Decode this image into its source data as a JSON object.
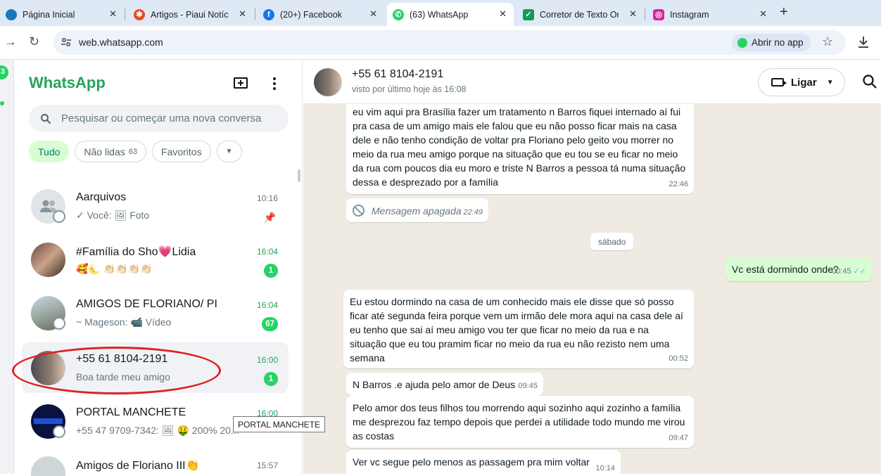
{
  "browser": {
    "tabs": [
      {
        "title": "Página Inicial",
        "icon": "edge-globe-icon",
        "color": "#1b75bb"
      },
      {
        "title": "Artigos - Piaui Notícias",
        "icon": "joomla-icon",
        "color": "#e44d26"
      },
      {
        "title": "(20+) Facebook",
        "icon": "facebook-icon",
        "color": "#1877f2"
      },
      {
        "title": "(63) WhatsApp",
        "icon": "whatsapp-icon",
        "color": "#25d366"
      },
      {
        "title": "Corretor de Texto Ortográfico",
        "icon": "corrector-icon",
        "color": "#0f9d58"
      },
      {
        "title": "Instagram",
        "icon": "instagram-icon",
        "color": "#d6249f"
      }
    ],
    "active_tab": 3,
    "url": "web.whatsapp.com",
    "open_app_label": "Abrir no app"
  },
  "rail": {
    "badge": "3"
  },
  "sidebar": {
    "brand": "WhatsApp",
    "search_placeholder": "Pesquisar ou começar uma nova conversa",
    "filters": [
      {
        "label": "Tudo",
        "count": ""
      },
      {
        "label": "Não lidas",
        "count": "63"
      },
      {
        "label": "Favoritos",
        "count": ""
      }
    ],
    "chats": [
      {
        "name": "Aarquivos",
        "preview": "✓ Você: 🖼 Foto",
        "time": "10:16",
        "badge": "",
        "pinned": true
      },
      {
        "name": "#Família do Sho💗Lidia",
        "preview": "🥰🌜        👏🏻👏🏻👏🏻👏🏻",
        "time": "16:04",
        "badge": "1",
        "pinned": false
      },
      {
        "name": "AMIGOS DE FLORIANO/ PI",
        "preview": "~ Mageson: 📹 Vídeo",
        "time": "16:04",
        "badge": "67",
        "pinned": false
      },
      {
        "name": "+55 61 8104-2191",
        "preview": "Boa tarde meu amigo",
        "time": "16:00",
        "badge": "1",
        "pinned": false
      },
      {
        "name": "PORTAL MANCHETE",
        "preview": "+55 47 9709-7342: 🖼 🤑 200% 20...",
        "time": "16:00",
        "badge": "",
        "pinned": false
      },
      {
        "name": "Amigos de Floriano III👏",
        "preview": "",
        "time": "15:57",
        "badge": "",
        "pinned": false
      }
    ],
    "tooltip": "PORTAL MANCHETE"
  },
  "chat": {
    "name": "+55 61 8104-2191",
    "last_seen": "visto por último hoje às 16:08",
    "call_label": "Ligar",
    "day_separator": "sábado",
    "messages": [
      {
        "dir": "in",
        "text": "eu vim aqui pra Brasília fazer um tratamento n Barros fiquei internado aí fui pra casa de um amigo mais ele falou que eu não posso ficar mais na casa dele e não tenho condição de voltar pra Floriano pelo geito vou morrer no meio da rua meu amigo porque na situação que eu tou se eu ficar no meio da rua com poucos dia eu moro e triste N Barros a pessoa tá numa situação dessa e desprezado por a família",
        "time": "22:46"
      },
      {
        "dir": "in",
        "text": "Mensagem apagada",
        "time": "22:49",
        "deleted": true
      },
      {
        "dir": "out",
        "text": "Vc está dormindo onde?",
        "time": "00:45"
      },
      {
        "dir": "in",
        "text": "Eu estou dormindo na casa de um conhecido mais ele disse que só posso ficar até segunda feira porque vem um irmão dele mora aqui na casa dele aí eu tenho que sai aí meu amigo vou ter que ficar no meio da rua e na situação que eu tou pramim ficar no meio da rua eu não rezisto nem uma semana",
        "time": "00:52"
      },
      {
        "dir": "in",
        "text": "N Barros .e ajuda pelo amor de Deus",
        "time": "09:45"
      },
      {
        "dir": "in",
        "text": "Pelo amor dos teus filhos tou morrendo aqui sozinho aqui zozinho a família me desprezou faz tempo depois que perdei a utilidade todo mundo me virou as costas",
        "time": "09:47"
      },
      {
        "dir": "in",
        "text": "Ver vc segue pelo menos as passagem pra mim voltar",
        "time": "10:14"
      }
    ]
  }
}
